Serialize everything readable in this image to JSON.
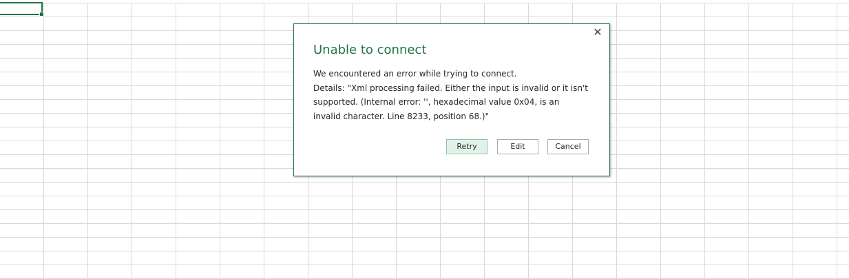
{
  "dialog": {
    "title": "Unable to connect",
    "message": "We encountered an error while trying to connect.",
    "details": "Details: \"Xml processing failed. Either the input is invalid or it isn't supported. (Internal error: '', hexadecimal value 0x04, is an invalid character. Line 8233, position 68.)\"",
    "close_icon": "close-icon",
    "buttons": {
      "retry": "Retry",
      "edit": "Edit",
      "cancel": "Cancel"
    }
  },
  "colors": {
    "accent": "#217346",
    "primary_button_bg": "#e3f2e9",
    "gridline": "#d9d9d9"
  }
}
